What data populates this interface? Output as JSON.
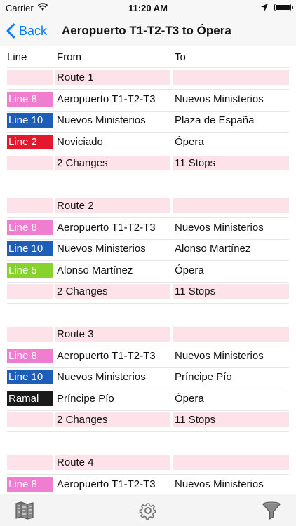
{
  "status": {
    "carrier": "Carrier",
    "time": "11:20 AM"
  },
  "nav": {
    "back_label": "Back",
    "title": "Aeropuerto T1-T2-T3 to Ópera"
  },
  "headers": {
    "line": "Line",
    "from": "From",
    "to": "To"
  },
  "colors": {
    "line8": "#f07ed0",
    "line10": "#1d5fb8",
    "line2": "#e3182d",
    "line5": "#88d22d",
    "ramal": "#1a1a1a",
    "pink": "#fde2ea",
    "accent": "#0a7aff"
  },
  "routes": [
    {
      "title": "Route 1",
      "legs": [
        {
          "line": "Line 8",
          "color": "#f07ed0",
          "from": "Aeropuerto T1-T2-T3",
          "to": "Nuevos Ministerios"
        },
        {
          "line": "Line 10",
          "color": "#1d5fb8",
          "from": "Nuevos Ministerios",
          "to": "Plaza de España"
        },
        {
          "line": "Line 2",
          "color": "#e3182d",
          "from": "Noviciado",
          "to": "Ópera"
        }
      ],
      "changes": "2 Changes",
      "stops": "11 Stops"
    },
    {
      "title": "Route 2",
      "legs": [
        {
          "line": "Line 8",
          "color": "#f07ed0",
          "from": "Aeropuerto T1-T2-T3",
          "to": "Nuevos Ministerios"
        },
        {
          "line": "Line 10",
          "color": "#1d5fb8",
          "from": "Nuevos Ministerios",
          "to": "Alonso Martínez"
        },
        {
          "line": "Line 5",
          "color": "#88d22d",
          "from": "Alonso Martínez",
          "to": "Ópera"
        }
      ],
      "changes": "2 Changes",
      "stops": "11 Stops"
    },
    {
      "title": "Route 3",
      "legs": [
        {
          "line": "Line 8",
          "color": "#f07ed0",
          "from": "Aeropuerto T1-T2-T3",
          "to": "Nuevos Ministerios"
        },
        {
          "line": "Line 10",
          "color": "#1d5fb8",
          "from": "Nuevos Ministerios",
          "to": "Príncipe Pío"
        },
        {
          "line": "Ramal",
          "color": "#1a1a1a",
          "from": "Príncipe Pío",
          "to": "Ópera"
        }
      ],
      "changes": "2 Changes",
      "stops": "11 Stops"
    },
    {
      "title": "Route 4",
      "legs": [
        {
          "line": "Line 8",
          "color": "#f07ed0",
          "from": "Aeropuerto T1-T2-T3",
          "to": "Nuevos Ministerios"
        }
      ]
    }
  ],
  "tabs": {
    "map_icon": "map-icon",
    "settings_icon": "gear-icon",
    "filter_icon": "filter-icon"
  }
}
